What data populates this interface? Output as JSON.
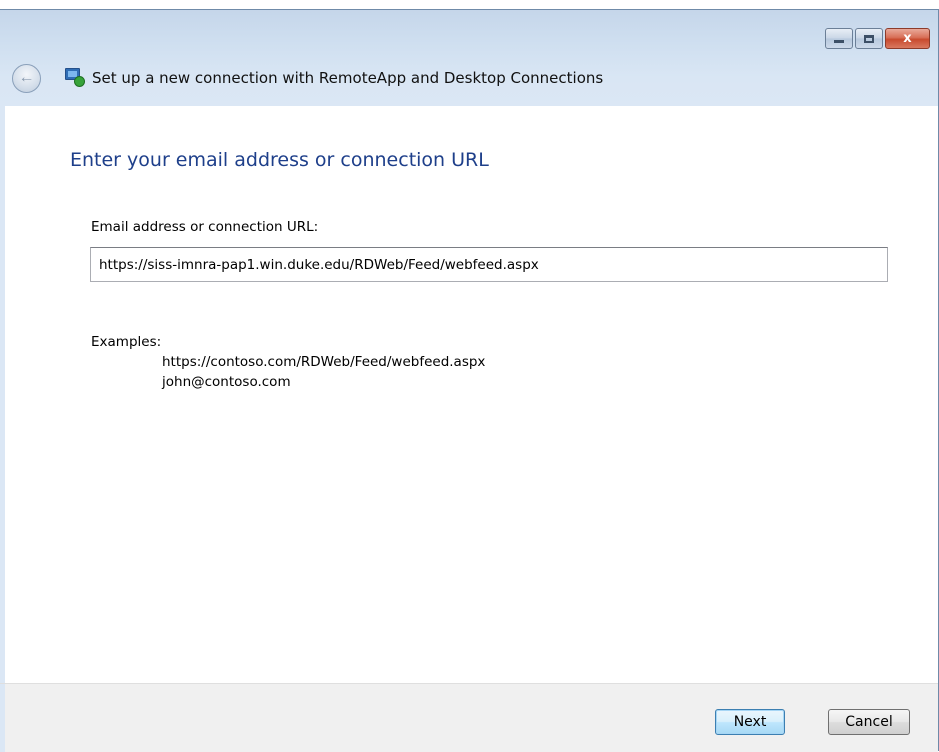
{
  "window": {
    "title": "Set up a new connection with RemoteApp and Desktop Connections",
    "caption_buttons": {
      "minimize": "minimize-icon",
      "maximize": "maximize-icon",
      "close": "x"
    },
    "back_icon": "back-arrow-icon",
    "app_icon": "remoteapp-connection-icon"
  },
  "main": {
    "heading": "Enter your email address or connection URL",
    "field_label": "Email address or connection URL:",
    "url_value": "https://siss-imnra-pap1.win.duke.edu/RDWeb/Feed/webfeed.aspx",
    "examples_label": "Examples:",
    "examples": [
      "https://contoso.com/RDWeb/Feed/webfeed.aspx",
      "john@contoso.com"
    ]
  },
  "footer": {
    "next_label": "Next",
    "cancel_label": "Cancel"
  },
  "colors": {
    "heading": "#1e3f8a",
    "frame": "#cfdff0",
    "close_button": "#c84a2e"
  }
}
